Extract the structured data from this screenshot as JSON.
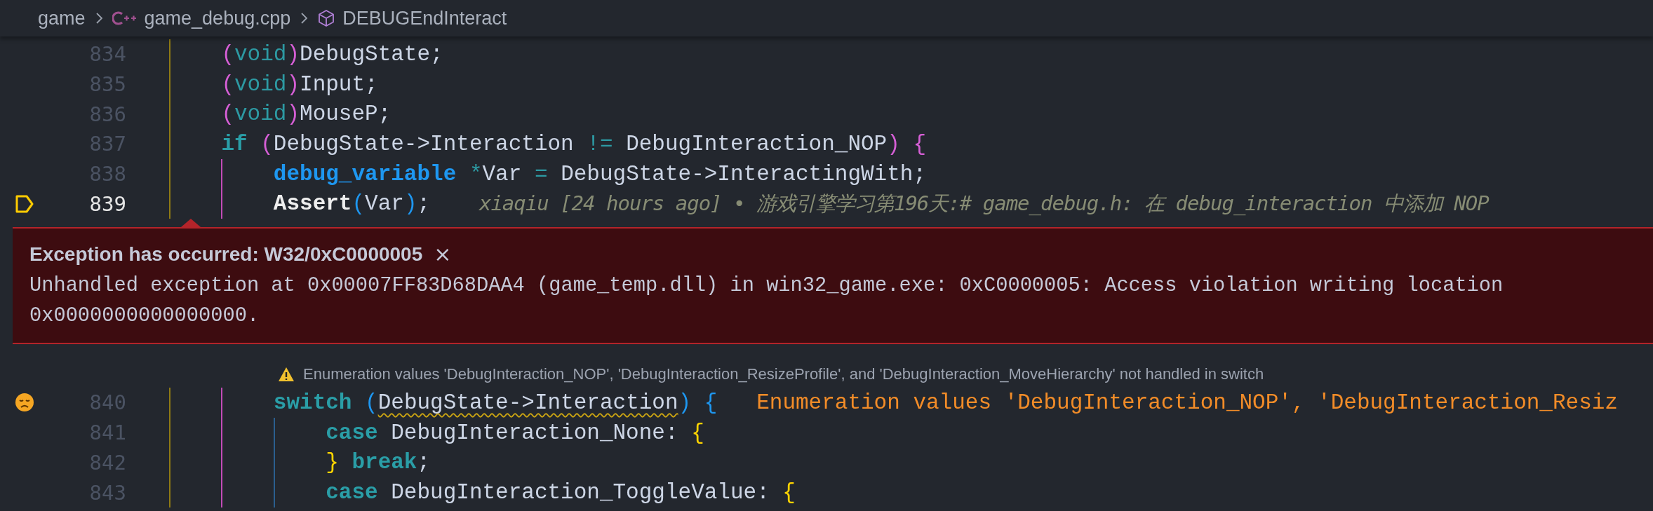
{
  "breadcrumbs": [
    {
      "label": "game",
      "kind": "folder"
    },
    {
      "label": "game_debug.cpp",
      "kind": "cpp-file"
    },
    {
      "label": "DEBUGEndInteract",
      "kind": "symbol"
    }
  ],
  "lines_top": [
    {
      "number": "834",
      "kind": "normal",
      "tokens": [
        {
          "kind": "paren1",
          "t": "    ("
        },
        {
          "kind": "type",
          "t": "void"
        },
        {
          "kind": "paren1",
          "t": ")"
        },
        {
          "kind": "plain",
          "t": "DebugState;"
        }
      ]
    },
    {
      "number": "835",
      "kind": "normal",
      "tokens": [
        {
          "kind": "paren1",
          "t": "    ("
        },
        {
          "kind": "type",
          "t": "void"
        },
        {
          "kind": "paren1",
          "t": ")"
        },
        {
          "kind": "plain",
          "t": "Input;"
        }
      ]
    },
    {
      "number": "836",
      "kind": "normal",
      "tokens": [
        {
          "kind": "paren1",
          "t": "    ("
        },
        {
          "kind": "type",
          "t": "void"
        },
        {
          "kind": "paren1",
          "t": ")"
        },
        {
          "kind": "plain",
          "t": "MouseP;"
        }
      ]
    },
    {
      "number": "837",
      "kind": "normal",
      "tokens": [
        {
          "kind": "keyword",
          "t": "    if"
        },
        {
          "kind": "paren1",
          "t": " ("
        },
        {
          "kind": "plain",
          "t": "DebugState->Interaction "
        },
        {
          "kind": "op",
          "t": "!="
        },
        {
          "kind": "plain",
          "t": " DebugInteraction_NOP"
        },
        {
          "kind": "paren1",
          "t": ")"
        },
        {
          "kind": "paren1",
          "t": " {"
        }
      ]
    },
    {
      "number": "838",
      "kind": "normal",
      "tokens": [
        {
          "kind": "typename",
          "t": "        debug_variable"
        },
        {
          "kind": "op",
          "t": " *"
        },
        {
          "kind": "plain",
          "t": "Var "
        },
        {
          "kind": "op",
          "t": "="
        },
        {
          "kind": "plain",
          "t": " DebugState->InteractingWith;"
        }
      ]
    },
    {
      "number": "839",
      "kind": "stopped",
      "tokens": [
        {
          "kind": "func",
          "t": "        Assert"
        },
        {
          "kind": "paren2",
          "t": "("
        },
        {
          "kind": "plain",
          "t": "Var"
        },
        {
          "kind": "paren2",
          "t": ")"
        },
        {
          "kind": "plain",
          "t": ";"
        }
      ],
      "annotation": "xiaqiu [24 hours ago] • 游戏引擎学习第196天:# game_debug.h: 在 debug_interaction 中添加 NOP"
    }
  ],
  "exception": {
    "title": "Exception has occurred: W32/0xC0000005",
    "close": "×",
    "message": "Unhandled exception at 0x00007FF83D68DAA4 (game_temp.dll) in win32_game.exe: 0xC0000005: Access violation writing location 0x0000000000000000."
  },
  "hint": {
    "text": "Enumeration values 'DebugInteraction_NOP', 'DebugInteraction_ResizeProfile', and 'DebugInteraction_MoveHierarchy' not handled in switch"
  },
  "lines_bottom": [
    {
      "number": "840",
      "kind": "warning",
      "tokens": [
        {
          "kind": "keyword",
          "t": "        switch"
        },
        {
          "kind": "paren2",
          "t": " ("
        },
        {
          "kind": "squiggle",
          "t": "DebugState->Interaction"
        },
        {
          "kind": "paren2",
          "t": ")"
        },
        {
          "kind": "paren2",
          "t": " {"
        }
      ],
      "annotation": "Enumeration values 'DebugInteraction_NOP', 'DebugInteraction_Resiz"
    },
    {
      "number": "841",
      "kind": "normal",
      "tokens": [
        {
          "kind": "keyword",
          "t": "            case"
        },
        {
          "kind": "plain",
          "t": " DebugInteraction_None: "
        },
        {
          "kind": "brace",
          "t": "{"
        }
      ]
    },
    {
      "number": "842",
      "kind": "normal",
      "tokens": [
        {
          "kind": "brace",
          "t": "            }"
        },
        {
          "kind": "keyword",
          "t": " break"
        },
        {
          "kind": "plain",
          "t": ";"
        }
      ]
    },
    {
      "number": "843",
      "kind": "normal",
      "tokens": [
        {
          "kind": "keyword",
          "t": "            case"
        },
        {
          "kind": "plain",
          "t": " DebugInteraction_ToggleValue: "
        },
        {
          "kind": "brace",
          "t": "{"
        }
      ]
    }
  ]
}
